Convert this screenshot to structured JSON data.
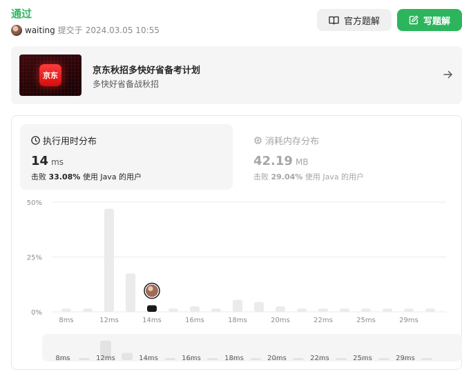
{
  "header": {
    "status": "通过",
    "username": "waiting",
    "submitted_label": "提交于",
    "submitted_at": "2024.03.05 10:55"
  },
  "buttons": {
    "solution_label": "官方题解",
    "write_label": "写题解"
  },
  "promo": {
    "logo_text": "京东",
    "title": "京东秋招多快好省备考计划",
    "subtitle": "多快好省备战秋招"
  },
  "runtime": {
    "title": "执行用时分布",
    "value": "14",
    "unit": "ms",
    "beat_prefix": "击败",
    "beat_pct": "33.08%",
    "beat_suffix": "使用 Java 的用户"
  },
  "memory": {
    "title": "消耗内存分布",
    "value": "42.19",
    "unit": "MB",
    "beat_prefix": "击败",
    "beat_pct": "29.04%",
    "beat_suffix": "使用 Java 的用户"
  },
  "colors": {
    "accepted": "#2db55d",
    "bar": "#ebebeb",
    "selected_bar": "#1a1a1a",
    "grid": "#ebebeb",
    "axis_text": "#8c8c8c"
  },
  "chart_data": {
    "type": "bar",
    "title": "",
    "xlabel": "",
    "ylabel": "",
    "ylim": [
      0,
      50
    ],
    "yticks": [
      "0%",
      "25%",
      "50%"
    ],
    "xtick_labels": [
      "8ms",
      "12ms",
      "14ms",
      "16ms",
      "18ms",
      "20ms",
      "22ms",
      "25ms",
      "29ms"
    ],
    "values": [
      1.5,
      1.5,
      47,
      17.5,
      2.5,
      1.5,
      2.5,
      1.5,
      5.5,
      4.5,
      2.5,
      1.5,
      1.5,
      1.5,
      1.5,
      1.5,
      1.5,
      1.5
    ],
    "selected_index": 4,
    "selected_value": 3,
    "grid": true,
    "legend": "none"
  }
}
